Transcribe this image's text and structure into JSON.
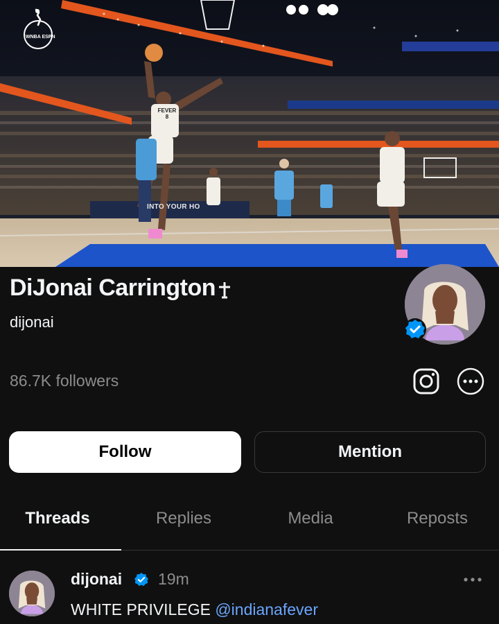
{
  "banner": {
    "logo_text": "WNBA ESPN",
    "jersey_team": "FEVER",
    "jersey_number": "8",
    "courtside_text": "INTO YOUR HO"
  },
  "profile": {
    "display_name": "DiJonai Carrington",
    "handle": "dijonai",
    "followers": "86.7K followers",
    "verified": true
  },
  "actions": {
    "follow_label": "Follow",
    "mention_label": "Mention"
  },
  "tabs": [
    {
      "label": "Threads",
      "active": true
    },
    {
      "label": "Replies",
      "active": false
    },
    {
      "label": "Media",
      "active": false
    },
    {
      "label": "Reposts",
      "active": false
    }
  ],
  "post": {
    "author": "dijonai",
    "time": "19m",
    "text": "WHITE PRIVILEGE",
    "mention": "@indianafever"
  },
  "colors": {
    "background": "#101010",
    "muted_text": "#8c8c8c",
    "verified_blue": "#0095f6",
    "mention_blue": "#6aa6ff"
  }
}
